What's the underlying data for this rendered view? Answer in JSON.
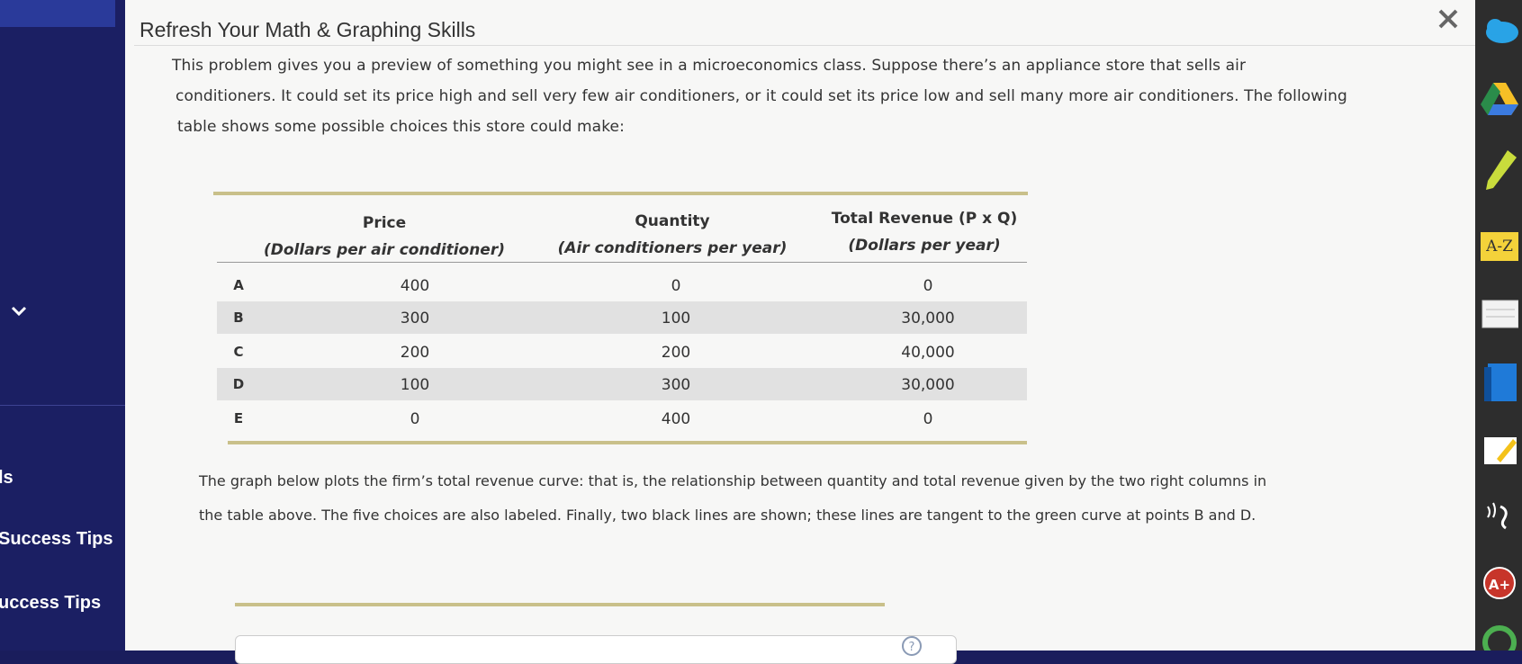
{
  "sidebar": {
    "partial_label_tools": "ls",
    "success_tips_1": "Success Tips",
    "success_tips_2": "uccess Tips"
  },
  "panel": {
    "title": "Refresh Your Math & Graphing Skills",
    "intro_lines": [
      "This problem gives you a preview of something you might see in a microeconomics class. Suppose there’s an appliance store that sells air",
      "conditioners. It could set its price high and sell very few air conditioners, or it could set its price low and sell many more air conditioners. The following",
      "table shows some possible choices this store could make:"
    ],
    "graph_lines": [
      "The graph below plots the firm’s total revenue curve: that is, the relationship between quantity and total revenue given by the two right columns in",
      "the table above. The five choices are also labeled. Finally, two black lines are shown; these lines are tangent to the green curve at points B and D."
    ]
  },
  "table": {
    "headers": [
      {
        "title": "Price",
        "sub": "(Dollars per air conditioner)"
      },
      {
        "title": "Quantity",
        "sub": "(Air conditioners per year)"
      },
      {
        "title": "Total Revenue (P x Q)",
        "sub": "(Dollars per year)"
      }
    ],
    "rows": [
      {
        "label": "A",
        "price": "400",
        "quantity": "0",
        "revenue": "0"
      },
      {
        "label": "B",
        "price": "300",
        "quantity": "100",
        "revenue": "30,000"
      },
      {
        "label": "C",
        "price": "200",
        "quantity": "200",
        "revenue": "40,000"
      },
      {
        "label": "D",
        "price": "100",
        "quantity": "300",
        "revenue": "30,000"
      },
      {
        "label": "E",
        "price": "0",
        "quantity": "400",
        "revenue": "0"
      }
    ]
  },
  "dock": {
    "az_label": "A-Z",
    "aplus_label": "A+"
  },
  "colors": {
    "sidebar_bg": "#1b1f63",
    "panel_bg": "#f7f7f6",
    "table_rule": "#c9c08a",
    "row_shade": "#e1e1e1"
  }
}
